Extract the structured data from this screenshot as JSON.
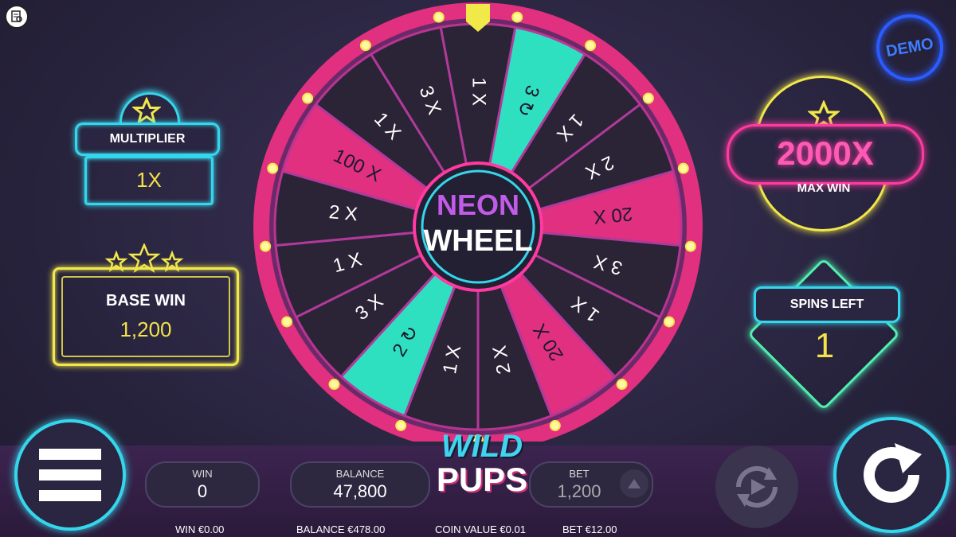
{
  "demo_badge": "DEMO",
  "multiplier": {
    "label": "MULTIPLIER",
    "value": "1X"
  },
  "base_win": {
    "label": "BASE WIN",
    "value": "1,200"
  },
  "max_win": {
    "value": "2000X",
    "label": "MAX WIN"
  },
  "spins_left": {
    "label": "SPINS LEFT",
    "value": "1"
  },
  "wheel": {
    "center_line1": "NEON",
    "center_line2": "WHEEL",
    "segments": [
      "1 X",
      "3 ↻",
      "1 X",
      "2 X",
      "20 X",
      "3 X",
      "1 X",
      "20 X",
      "2 X",
      "1 X",
      "2 ↻",
      "3 X",
      "1 X",
      "2 X",
      "100 X",
      "1 X",
      "3 X"
    ]
  },
  "logo": {
    "line1": "WILD",
    "line2": "PUPS"
  },
  "bar": {
    "win_label": "WIN",
    "win_value": "0",
    "balance_label": "BALANCE",
    "balance_value": "47,800",
    "bet_label": "BET",
    "bet_value": "1,200"
  },
  "footer": {
    "win": "WIN €0.00",
    "balance": "BALANCE €478.00",
    "coin_value": "COIN VALUE €0.01",
    "bet": "BET €12.00"
  },
  "colors": {
    "cyan": "#35d6ec",
    "pink": "#ff3aa0",
    "yellow": "#f1e84a",
    "teal_segment": "#2fe0c0",
    "wheel_pink": "#e0307f"
  },
  "icons": [
    "info-icon",
    "star-icon",
    "menu-icon",
    "autoplay-icon",
    "spin-icon",
    "bet-up-icon"
  ]
}
